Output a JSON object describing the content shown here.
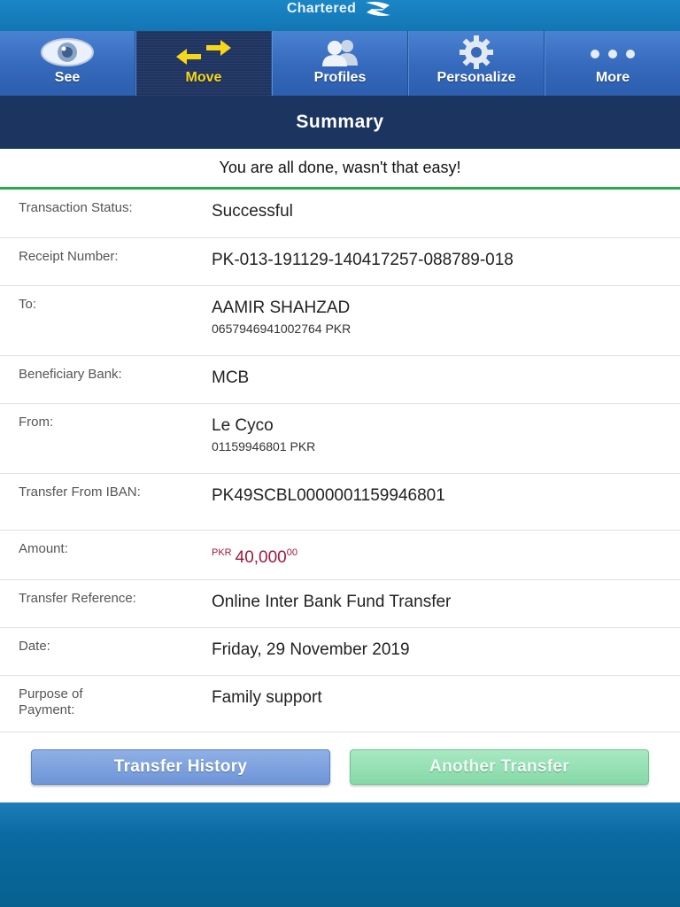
{
  "app": {
    "brand": "Chartered"
  },
  "nav": {
    "items": [
      {
        "label": "See",
        "icon": "eye-icon",
        "active": false
      },
      {
        "label": "Move",
        "icon": "arrows-icon",
        "active": true
      },
      {
        "label": "Profiles",
        "icon": "people-icon",
        "active": false
      },
      {
        "label": "Personalize",
        "icon": "gear-icon",
        "active": false
      },
      {
        "label": "More",
        "icon": "ellipsis-icon",
        "active": false
      }
    ]
  },
  "summary": {
    "title": "Summary",
    "message": "You are all done, wasn't that easy!"
  },
  "details": {
    "status_label": "Transaction Status:",
    "status_value": "Successful",
    "receipt_label": "Receipt Number:",
    "receipt_value": "PK-013-191129-140417257-088789-018",
    "to_label": "To:",
    "to_name": "AAMIR SHAHZAD",
    "to_account": "0657946941002764 PKR",
    "bank_label": "Beneficiary Bank:",
    "bank_value": "MCB",
    "from_label": "From:",
    "from_name": "Le Cyco",
    "from_account": "01159946801 PKR",
    "iban_label": "Transfer From IBAN:",
    "iban_value": "PK49SCBL0000001159946801",
    "amount_label": "Amount:",
    "amount_currency": "PKR",
    "amount_whole": "40,000",
    "amount_decimal": "00",
    "reference_label": "Transfer Reference:",
    "reference_value": "Online Inter Bank Fund Transfer",
    "date_label": "Date:",
    "date_value": "Friday, 29 November 2019",
    "purpose_label": "Purpose of Payment:",
    "purpose_value": "Family support"
  },
  "actions": {
    "history_label": "Transfer History",
    "another_label": "Another Transfer"
  },
  "colors": {
    "accent_green": "#2aa84a",
    "amount_red": "#a0183a",
    "header_navy": "#1c3460",
    "active_tab_text": "#f7d718"
  }
}
